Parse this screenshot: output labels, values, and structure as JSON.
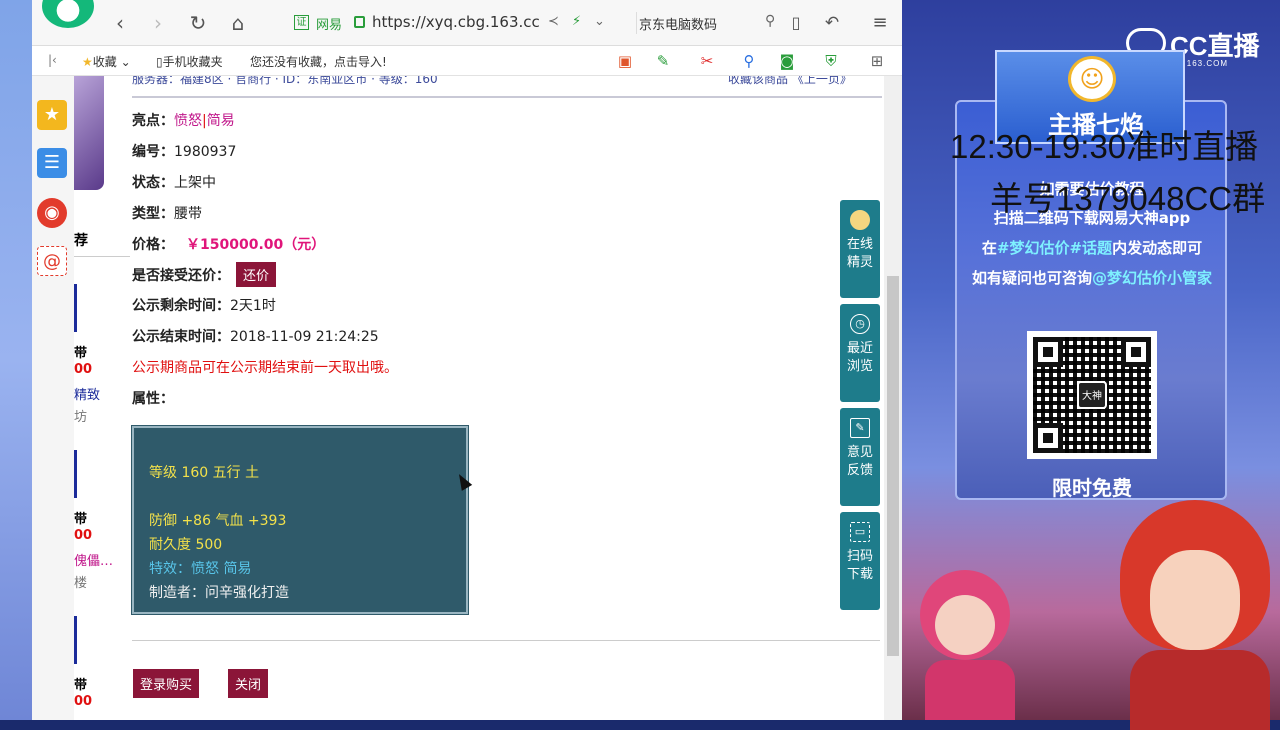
{
  "browser": {
    "url_site": "网易",
    "url": "https://xyq.cbg.163.cc",
    "search_text": "京东电脑数码",
    "favorites_label": "收藏",
    "mobile_favorites_label": "手机收藏夹",
    "no_favorites_text": "您还没有收藏，点击导入!"
  },
  "sidebar_list": {
    "tab_label": "荐",
    "items": [
      {
        "name": "带",
        "price": "00",
        "desc": "精致",
        "seller": "坊"
      },
      {
        "name": "带",
        "price": "00",
        "desc": "傀儡…",
        "seller": "楼"
      },
      {
        "name": "带",
        "price": "00"
      }
    ]
  },
  "detail": {
    "top_line": "服务器：福建8区 · 官商行 · ID：东南亚区市 · 等级：160",
    "top_right": "收藏该商品  《上一页》",
    "highlight_label": "亮点：",
    "highlight_value_1": "愤怒",
    "highlight_value_2": "简易",
    "id_label": "编号：",
    "id_value": "1980937",
    "status_label": "状态：",
    "status_value": "上架中",
    "type_label": "类型：",
    "type_value": "腰带",
    "price_label": "价格：",
    "price_value": "￥150000.00（元）",
    "counter_label": "是否接受还价：",
    "counter_button": "还价",
    "remaining_label": "公示剩余时间：",
    "remaining_value": "2天1时",
    "end_label": "公示结束时间：",
    "end_value": "2018-11-09 21:24:25",
    "notice": "公示期商品可在公示期结束前一天取出哦。",
    "attr_label": "属性：",
    "attr": {
      "level_line": "等级 160 五行 土",
      "stats_line": "防御 +86 气血 +393",
      "durability_line": "耐久度 500",
      "special_line": "特效：愤怒 简易",
      "maker_line": "制造者：问辛强化打造"
    },
    "buy_button": "登录购买",
    "close_button": "关闭"
  },
  "side_panel": [
    {
      "label_1": "在线",
      "label_2": "精灵"
    },
    {
      "label_1": "最近",
      "label_2": "浏览"
    },
    {
      "label_1": "意见",
      "label_2": "反馈"
    },
    {
      "label_1": "扫码",
      "label_2": "下载"
    }
  ],
  "overlay": {
    "cc_logo": "CC直播",
    "cc_sub": "CC.163.COM",
    "anchor_name": "主播七焰",
    "schedule": "12:30-19:30准时直播",
    "group": "羊号1379048CC群",
    "poster_line_1": "如需要估价教程",
    "poster_line_2": "扫描二维码下载网易大神app",
    "poster_line_3_a": "在",
    "poster_line_3_b": "#梦幻估价#话题",
    "poster_line_3_c": "内发动态即可",
    "poster_line_4_a": "如有疑问也可咨询",
    "poster_line_4_b": "@梦幻估价小管家",
    "qr_center": "大神",
    "free": "限时免费"
  }
}
